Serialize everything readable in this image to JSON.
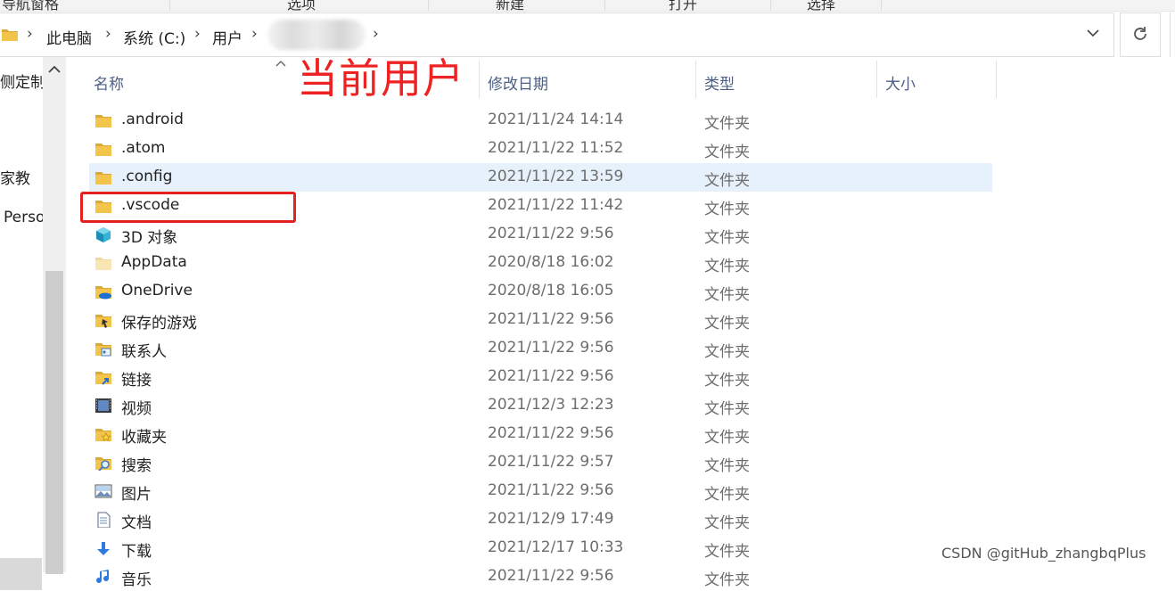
{
  "ribbon": {
    "items": [
      "导航窗格",
      "选项",
      "新建",
      "打开",
      "选择"
    ]
  },
  "address": {
    "crumbs": [
      "此电脑",
      "系统 (C:)",
      "用户"
    ],
    "dropdown_icon": "chevron-down-icon",
    "refresh_icon": "refresh-icon"
  },
  "nav": {
    "items": [
      "侧定制",
      "家教",
      "Perso"
    ]
  },
  "columns": {
    "name": "名称",
    "date": "修改日期",
    "type": "类型",
    "size": "大小"
  },
  "annotation": {
    "label": "当前用户",
    "color": "#ee2222"
  },
  "files": [
    {
      "name": ".android",
      "date": "2021/11/24 14:14",
      "type": "文件夹",
      "icon": "folder-icon"
    },
    {
      "name": ".atom",
      "date": "2021/11/22 11:52",
      "type": "文件夹",
      "icon": "folder-icon"
    },
    {
      "name": ".config",
      "date": "2021/11/22 13:59",
      "type": "文件夹",
      "icon": "folder-icon"
    },
    {
      "name": ".vscode",
      "date": "2021/11/22 11:42",
      "type": "文件夹",
      "icon": "folder-icon"
    },
    {
      "name": "3D 对象",
      "date": "2021/11/22 9:56",
      "type": "文件夹",
      "icon": "3d-objects-icon"
    },
    {
      "name": "AppData",
      "date": "2020/8/18 16:02",
      "type": "文件夹",
      "icon": "folder-faded-icon"
    },
    {
      "name": "OneDrive",
      "date": "2020/8/18 16:05",
      "type": "文件夹",
      "icon": "onedrive-folder-icon"
    },
    {
      "name": "保存的游戏",
      "date": "2021/11/22 9:56",
      "type": "文件夹",
      "icon": "saved-games-icon"
    },
    {
      "name": "联系人",
      "date": "2021/11/22 9:56",
      "type": "文件夹",
      "icon": "contacts-icon"
    },
    {
      "name": "链接",
      "date": "2021/11/22 9:56",
      "type": "文件夹",
      "icon": "links-icon"
    },
    {
      "name": "视频",
      "date": "2021/12/3 12:23",
      "type": "文件夹",
      "icon": "videos-icon"
    },
    {
      "name": "收藏夹",
      "date": "2021/11/22 9:56",
      "type": "文件夹",
      "icon": "favorites-icon"
    },
    {
      "name": "搜索",
      "date": "2021/11/22 9:57",
      "type": "文件夹",
      "icon": "searches-icon"
    },
    {
      "name": "图片",
      "date": "2021/11/22 9:56",
      "type": "文件夹",
      "icon": "pictures-icon"
    },
    {
      "name": "文档",
      "date": "2021/12/9 17:49",
      "type": "文件夹",
      "icon": "documents-icon"
    },
    {
      "name": "下载",
      "date": "2021/12/17 10:33",
      "type": "文件夹",
      "icon": "downloads-icon"
    },
    {
      "name": "音乐",
      "date": "2021/11/22 9:56",
      "type": "文件夹",
      "icon": "music-icon"
    }
  ],
  "colors": {
    "folder": "#f3c44a",
    "hover_row": "#e6f1fb",
    "header_text": "#4d6082"
  },
  "watermark": "CSDN @gitHub_zhangbqPlus"
}
